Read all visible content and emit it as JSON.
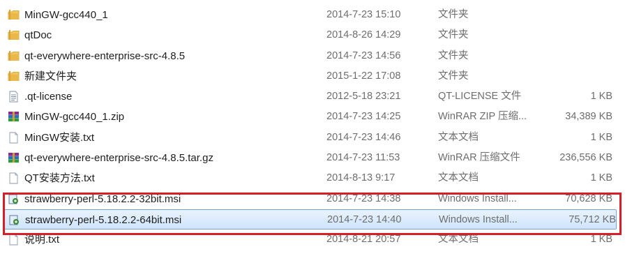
{
  "files": [
    {
      "name": "MinGW-gcc440_1",
      "date": "2014-7-23 15:10",
      "type": "文件夹",
      "size": "",
      "icon": "folder-icon"
    },
    {
      "name": "qtDoc",
      "date": "2014-8-26 14:29",
      "type": "文件夹",
      "size": "",
      "icon": "folder-icon"
    },
    {
      "name": "qt-everywhere-enterprise-src-4.8.5",
      "date": "2014-7-23 14:56",
      "type": "文件夹",
      "size": "",
      "icon": "folder-icon"
    },
    {
      "name": "新建文件夹",
      "date": "2015-1-22 17:08",
      "type": "文件夹",
      "size": "",
      "icon": "folder-icon"
    },
    {
      "name": ".qt-license",
      "date": "2012-5-18 23:21",
      "type": "QT-LICENSE 文件",
      "size": "1 KB",
      "icon": "text-file-icon"
    },
    {
      "name": "MinGW-gcc440_1.zip",
      "date": "2014-7-23 14:25",
      "type": "WinRAR ZIP 压缩...",
      "size": "34,389 KB",
      "icon": "winrar-archive-icon"
    },
    {
      "name": "MinGW安装.txt",
      "date": "2014-7-23 14:46",
      "type": "文本文档",
      "size": "1 KB",
      "icon": "blank-document-icon"
    },
    {
      "name": "qt-everywhere-enterprise-src-4.8.5.tar.gz",
      "date": "2014-7-23 11:53",
      "type": "WinRAR 压缩文件",
      "size": "236,556 KB",
      "icon": "winrar-archive-icon"
    },
    {
      "name": "QT安装方法.txt",
      "date": "2014-8-13 9:17",
      "type": "文本文档",
      "size": "1 KB",
      "icon": "blank-document-icon"
    },
    {
      "name": "strawberry-perl-5.18.2.2-32bit.msi",
      "date": "2014-7-23 14:38",
      "type": "Windows Install...",
      "size": "70,628 KB",
      "icon": "msi-installer-icon"
    },
    {
      "name": "strawberry-perl-5.18.2.2-64bit.msi",
      "date": "2014-7-23 14:40",
      "type": "Windows Install...",
      "size": "75,712 KB",
      "icon": "msi-installer-icon"
    },
    {
      "name": "说明.txt",
      "date": "2014-8-21 20:57",
      "type": "文本文档",
      "size": "1 KB",
      "icon": "blank-document-icon"
    }
  ],
  "selected_index": 10,
  "colors": {
    "highlight_border": "#d41f2b",
    "selection_bg": "#cfe4fb",
    "selection_border": "#7da2ce",
    "folder": "#e8b84a"
  }
}
